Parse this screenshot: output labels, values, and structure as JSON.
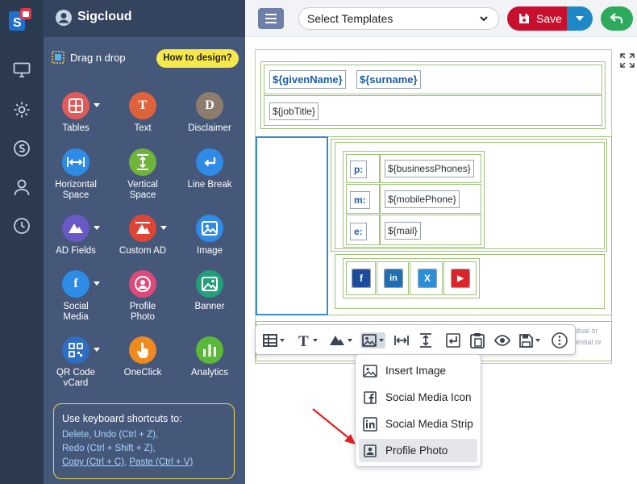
{
  "app": {
    "name": "Sigcloud"
  },
  "header": {
    "template_select": "Select Templates",
    "save_label": "Save"
  },
  "rail": {
    "icons": [
      "monitor-icon",
      "gear-icon",
      "signature-icon",
      "user-icon",
      "history-icon"
    ]
  },
  "panel": {
    "title": "Drag n drop",
    "how_to": "How to design?",
    "tools": [
      {
        "label": "Tables",
        "glyph": "",
        "color": "#e05a5a",
        "caret": true
      },
      {
        "label": "Text",
        "glyph": "T",
        "color": "#e0623a"
      },
      {
        "label": "Disclaimer",
        "glyph": "D",
        "color": "#8e7d6e"
      },
      {
        "label": "Horizontal Space",
        "glyph": "",
        "color": "#2e8be6"
      },
      {
        "label": "Vertical Space",
        "glyph": "",
        "color": "#6fb33b"
      },
      {
        "label": "Line Break",
        "glyph": "",
        "color": "#2e8be6"
      },
      {
        "label": "AD Fields",
        "glyph": "",
        "color": "#6a58c4",
        "caret": true
      },
      {
        "label": "Custom AD",
        "glyph": "",
        "color": "#e04434",
        "caret": true
      },
      {
        "label": "Image",
        "glyph": "",
        "color": "#2e8be6"
      },
      {
        "label": "Social Media",
        "glyph": "f",
        "color": "#2e8be6",
        "caret": true
      },
      {
        "label": "Profile Photo",
        "glyph": "",
        "color": "#e0487a"
      },
      {
        "label": "Banner",
        "glyph": "",
        "color": "#22a07a"
      },
      {
        "label": "QR Code vCard",
        "glyph": "",
        "color": "#2e6fc4",
        "caret": true
      },
      {
        "label": "OneClick",
        "glyph": "",
        "color": "#f08a1f"
      },
      {
        "label": "Analytics",
        "glyph": "",
        "color": "#5cb83a"
      }
    ],
    "shortcuts": {
      "title": "Use keyboard shortcuts to:",
      "line1": "Delete, Undo (Ctrl + Z),",
      "line2": "Redo (Ctrl + Shift + Z),",
      "copy": "Copy (Ctrl + C)",
      "sep": ", ",
      "paste": "Paste (Ctrl + V)"
    }
  },
  "signature": {
    "given_name": "${givenName}",
    "surname": "${surname}",
    "job_title": "${jobTitle}",
    "rows": [
      {
        "label": "p:",
        "value": "${businessPhones}"
      },
      {
        "label": "m:",
        "value": "${mobilePhone}"
      },
      {
        "label": "e:",
        "value": "${mail}"
      }
    ],
    "social": [
      {
        "name": "facebook",
        "glyph": "f",
        "color": "#1c4a9c"
      },
      {
        "name": "linkedin",
        "glyph": "in",
        "color": "#1f6fb3"
      },
      {
        "name": "x",
        "glyph": "X",
        "color": "#2a8fd6"
      },
      {
        "name": "youtube",
        "glyph": "▶",
        "color": "#d9252a"
      }
    ],
    "hidden_text": [
      "dual or",
      "ential or"
    ]
  },
  "menu": {
    "items": [
      {
        "label": "Insert Image",
        "icon": "image-icon"
      },
      {
        "label": "Social Media Icon",
        "icon": "facebook-icon"
      },
      {
        "label": "Social Media Strip",
        "icon": "social-strip-icon"
      },
      {
        "label": "Profile Photo",
        "icon": "profile-photo-icon",
        "selected": true
      }
    ]
  }
}
